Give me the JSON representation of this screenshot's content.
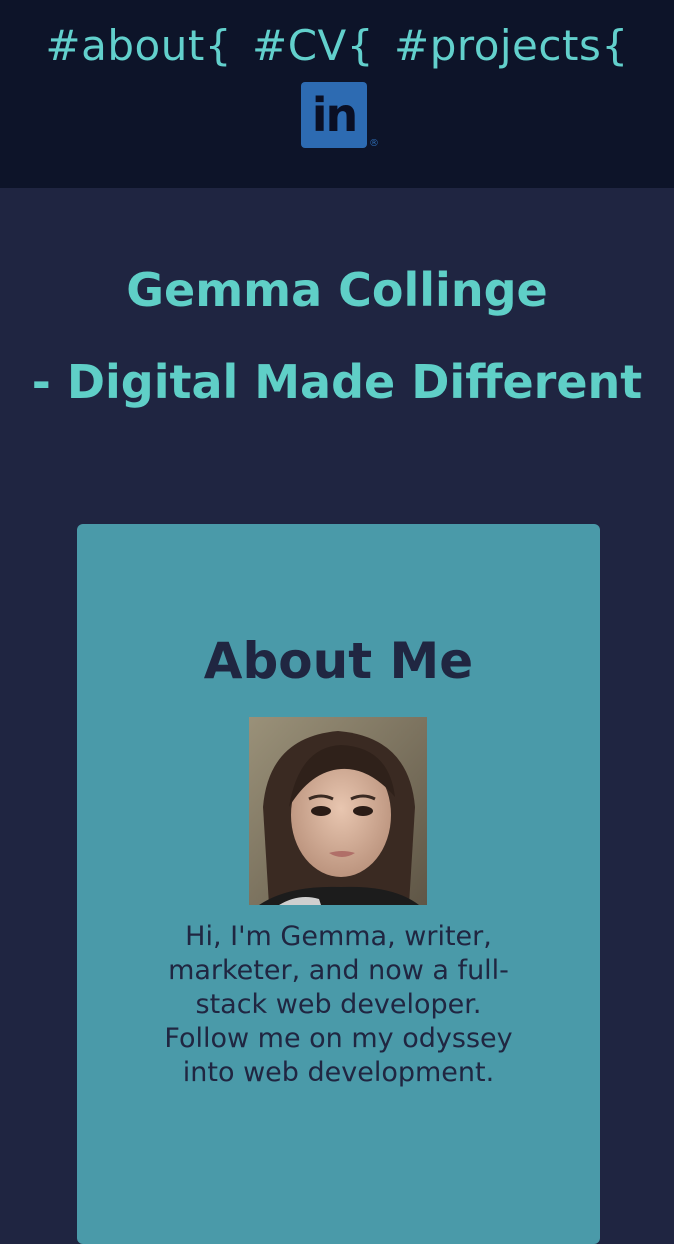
{
  "nav": {
    "links": [
      {
        "label": "#about{"
      },
      {
        "label": "#CV{"
      },
      {
        "label": "#projects{"
      }
    ],
    "linkedin_label": "in"
  },
  "hero": {
    "title_line1": "Gemma Collinge",
    "title_line2": "- Digital Made Different"
  },
  "about": {
    "heading": "About Me",
    "bio_line1": "Hi, I'm Gemma, writer, marketer, and now a full-stack web developer.",
    "bio_line2": "Follow me on my odyssey into web development."
  },
  "colors": {
    "nav_bg": "#0d1429",
    "page_bg": "#1f2541",
    "accent": "#5fcfc7",
    "card_bg": "#4a9aa9",
    "linkedin": "#2d6bb2",
    "text_dark": "#202641"
  }
}
